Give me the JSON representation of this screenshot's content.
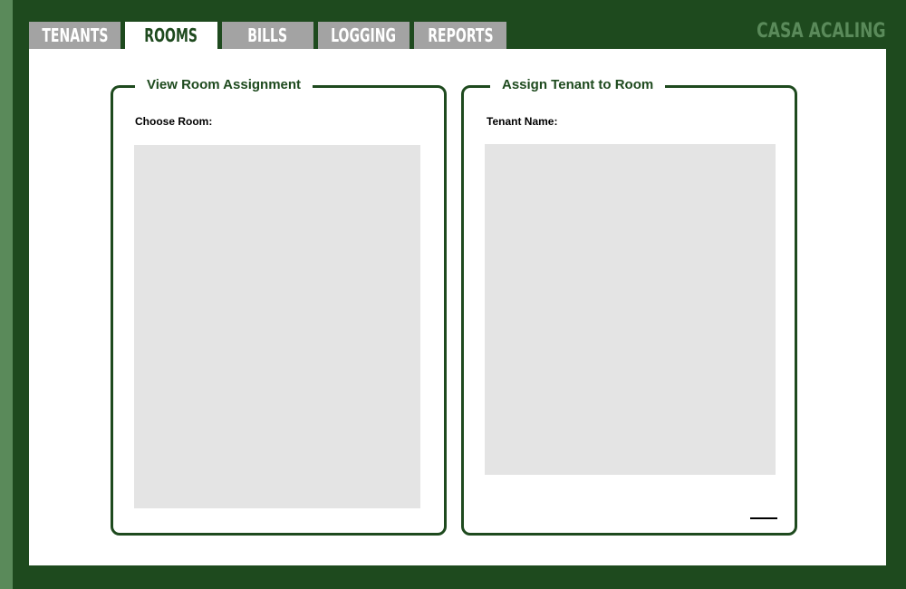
{
  "brand": "CASA ACALING",
  "tabs": [
    {
      "label": "TENANTS",
      "active": false
    },
    {
      "label": "ROOMS",
      "active": true
    },
    {
      "label": "BILLS",
      "active": false
    },
    {
      "label": "LOGGING",
      "active": false
    },
    {
      "label": "REPORTS",
      "active": false
    }
  ],
  "view_panel": {
    "title": "View Room Assignment",
    "choose_room_label": "Choose Room:"
  },
  "assign_panel": {
    "title": "Assign Tenant to Room",
    "tenant_name_label": "Tenant Name:"
  },
  "colors": {
    "frame": "#1e4a1e",
    "accent_light": "#5a8a5a",
    "tab_inactive": "#a3a3a3",
    "list_bg": "#e4e4e4"
  }
}
